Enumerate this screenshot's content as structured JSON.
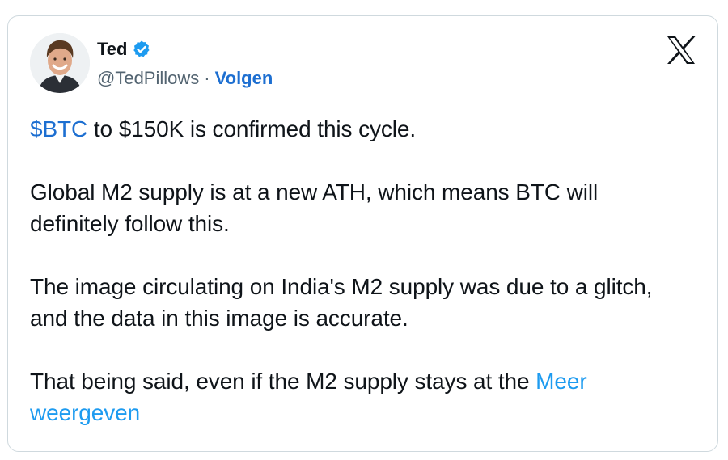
{
  "tweet": {
    "author_name": "Ted",
    "handle": "@TedPillows",
    "separator": "·",
    "follow_label": "Volgen",
    "cashtag": "$BTC",
    "line1_rest": " to $150K is confirmed this cycle.",
    "paragraph2": "Global M2 supply is at a new ATH, which means BTC will definitely follow this.",
    "paragraph3": "The image circulating on India's M2 supply was due to a glitch, and the data in this image is accurate.",
    "paragraph4": "That being said, even if the M2 supply stays at the ",
    "show_more": "Meer weergeven"
  },
  "icons": {
    "avatar": "profile-photo",
    "verified": "verified-badge-icon",
    "platform": "x-logo-icon"
  },
  "colors": {
    "link": "#1d6fd1",
    "show_more": "#1d9bf0",
    "verified": "#1d9bf0",
    "muted": "#536471",
    "border": "#cfd9de"
  }
}
